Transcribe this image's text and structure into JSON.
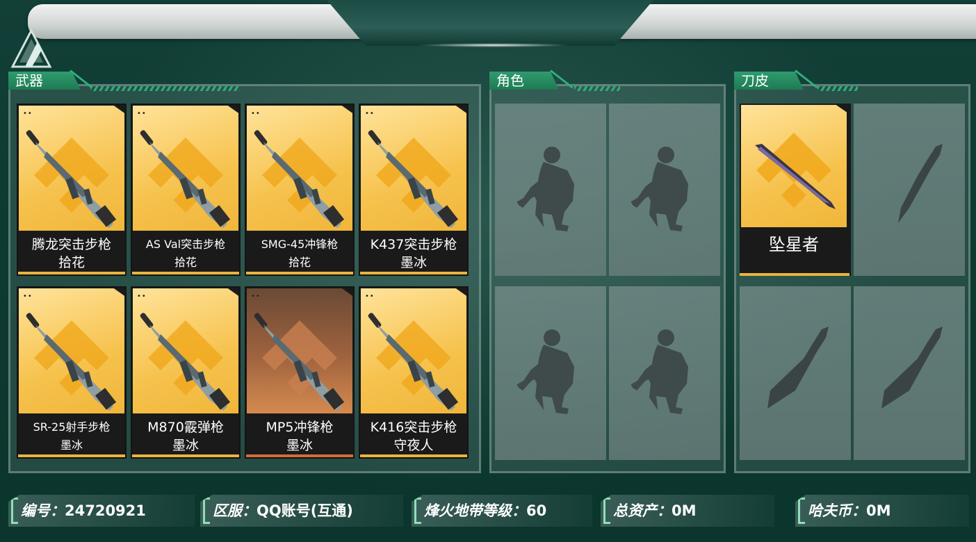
{
  "sections": {
    "weapons": "武器",
    "characters": "角色",
    "knives": "刀皮"
  },
  "weapons": [
    {
      "name": "腾龙突击步枪",
      "skin": "拾花",
      "rarity": "gold"
    },
    {
      "name": "AS Val突击步枪",
      "skin": "拾花",
      "rarity": "gold"
    },
    {
      "name": "SMG-45冲锋枪",
      "skin": "拾花",
      "rarity": "gold"
    },
    {
      "name": "K437突击步枪",
      "skin": "墨冰",
      "rarity": "gold"
    },
    {
      "name": "SR-25射手步枪",
      "skin": "墨冰",
      "rarity": "gold"
    },
    {
      "name": "M870霰弹枪",
      "skin": "墨冰",
      "rarity": "gold"
    },
    {
      "name": "MP5冲锋枪",
      "skin": "墨冰",
      "rarity": "orange"
    },
    {
      "name": "K416突击步枪",
      "skin": "守夜人",
      "rarity": "gold"
    }
  ],
  "knife": {
    "name": "坠星者"
  },
  "info": {
    "id_label": "编号：",
    "id_value": "24720921",
    "server_label": "区服：",
    "server_value": "QQ账号(互通)",
    "level_label": "烽火地带等级：",
    "level_value": "60",
    "assets_label": "总资产：",
    "assets_value": "0M",
    "currency_label": "哈夫币：",
    "currency_value": "0M"
  },
  "colors": {
    "gold_card": "#f6c24d",
    "orange_card": "#a0633e",
    "section_green": "#2f9c6e",
    "background": "#0f3a32"
  }
}
